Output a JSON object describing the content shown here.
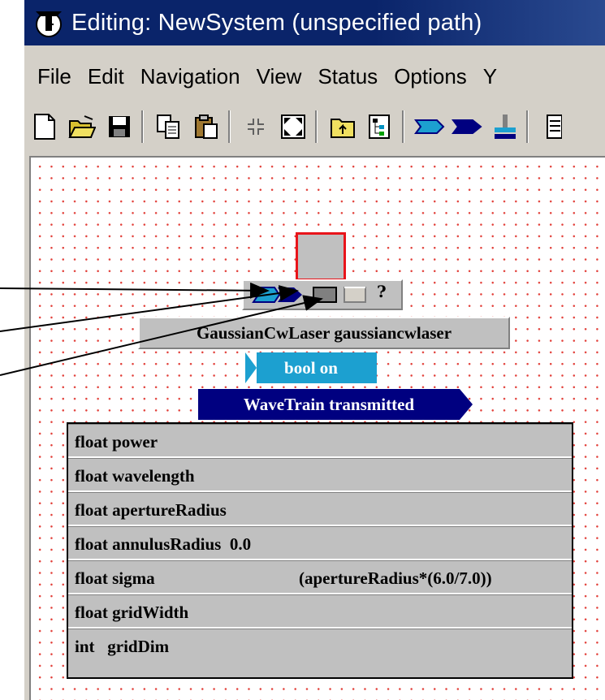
{
  "window": {
    "title": "Editing: NewSystem  (unspecified path)"
  },
  "menu": [
    "File",
    "Edit",
    "Navigation",
    "View",
    "Status",
    "Options",
    "Y"
  ],
  "toolbar": {
    "icons": [
      "new-file-icon",
      "open-folder-icon",
      "save-icon",
      "copy-icon",
      "paste-icon",
      "collapse-icon",
      "expand-icon",
      "up-folder-icon",
      "tree-icon",
      "input-port-icon",
      "output-port-icon",
      "connect-icon",
      "list-icon"
    ]
  },
  "block": {
    "name_label": "GaussianCwLaser gaussiancwlaser",
    "qmark": "?",
    "parameter_input": "bool on",
    "output_port": "WaveTrain transmitted",
    "parameters": [
      {
        "name": "float power",
        "value": ""
      },
      {
        "name": "float wavelength",
        "value": ""
      },
      {
        "name": "float apertureRadius",
        "value": ""
      },
      {
        "name": "float annulusRadius  0.0",
        "value": ""
      },
      {
        "name": "float sigma",
        "value": "(apertureRadius*(6.0/7.0))"
      },
      {
        "name": "float gridWidth",
        "value": ""
      },
      {
        "name": "int   gridDim",
        "value": ""
      }
    ]
  },
  "colors": {
    "title_bar": "#0a246a",
    "canvas_dots": "#e2403a",
    "param_input": "#1ca0d0",
    "output_port": "#000080",
    "selection_border": "#e8141a"
  }
}
